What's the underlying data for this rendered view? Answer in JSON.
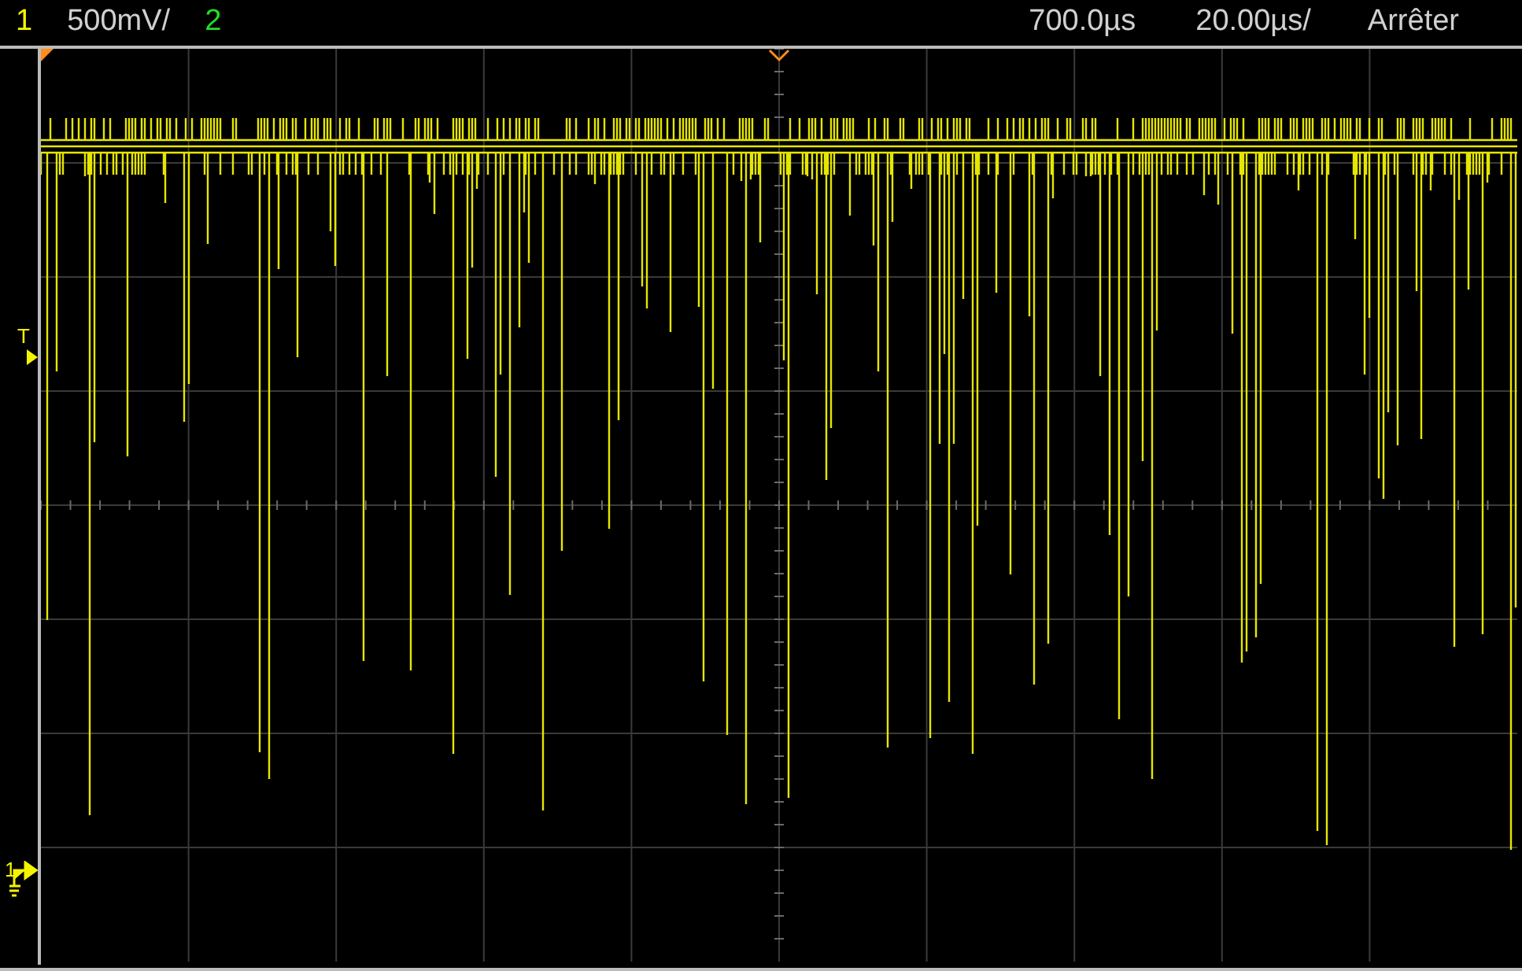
{
  "status_bar": {
    "channel_1": "1",
    "channel_1_scale": "500mV/",
    "channel_2": "2",
    "time_delay": "700.0µs",
    "time_scale": "20.00µs/",
    "run_state": "Arrêter"
  },
  "markers": {
    "trigger_label": "T",
    "ground_label": "1"
  }
}
